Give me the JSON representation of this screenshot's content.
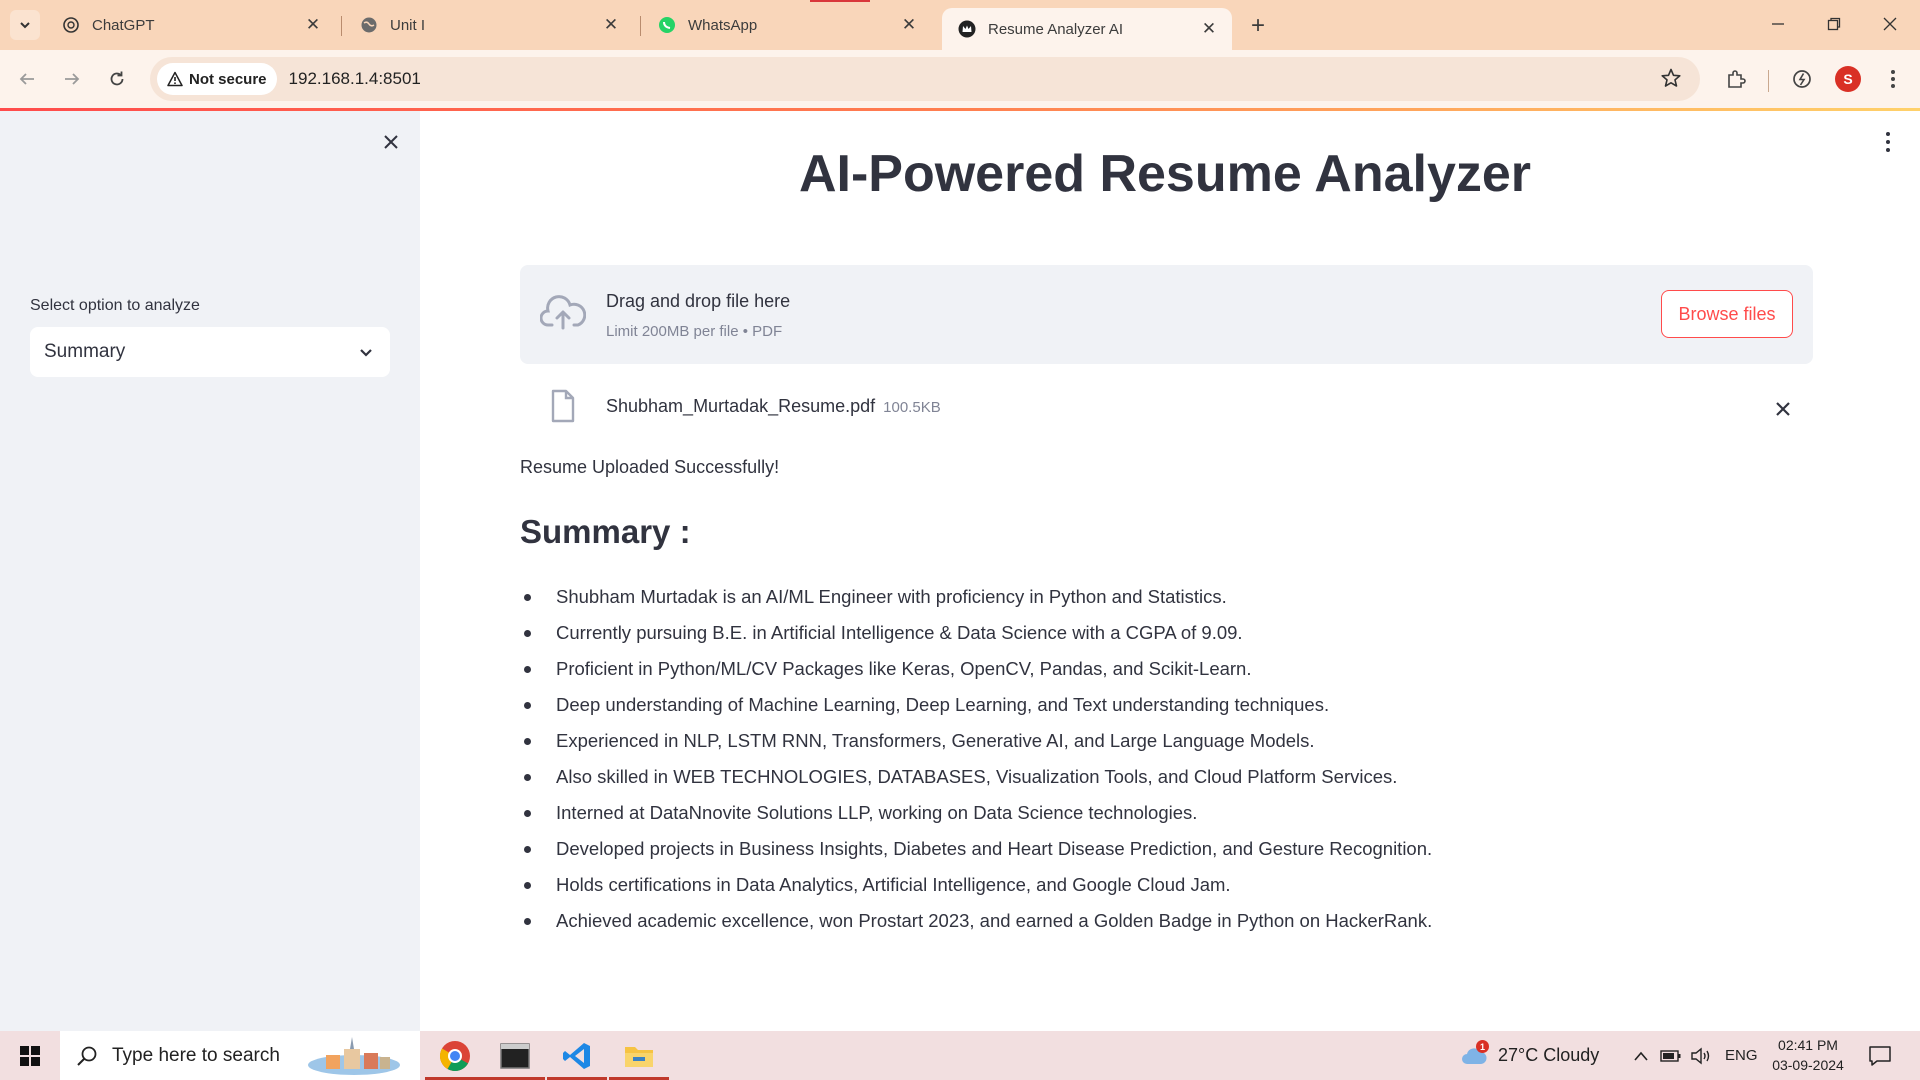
{
  "browser": {
    "tabs": [
      {
        "title": "ChatGPT",
        "icon": "chatgpt-icon"
      },
      {
        "title": "Unit I",
        "icon": "globe-icon"
      },
      {
        "title": "WhatsApp",
        "icon": "whatsapp-icon"
      },
      {
        "title": "Resume Analyzer AI",
        "icon": "streamlit-crown-icon",
        "active": true
      }
    ],
    "address": {
      "security_label": "Not secure",
      "url": "192.168.1.4:8501"
    },
    "profile_initial": "S"
  },
  "sidebar": {
    "select_label": "Select option to analyze",
    "select_value": "Summary"
  },
  "main": {
    "title": "AI-Powered Resume Analyzer",
    "uploader": {
      "title": "Drag and drop file here",
      "limit": "Limit 200MB per file • PDF",
      "browse_label": "Browse files"
    },
    "file": {
      "name": "Shubham_Murtadak_Resume.pdf",
      "size": "100.5KB"
    },
    "success_message": "Resume Uploaded Successfully!",
    "summary_heading": "Summary :",
    "summary_points": [
      "Shubham Murtadak is an AI/ML Engineer with proficiency in Python and Statistics.",
      "Currently pursuing B.E. in Artificial Intelligence & Data Science with a CGPA of 9.09.",
      "Proficient in Python/ML/CV Packages like Keras, OpenCV, Pandas, and Scikit-Learn.",
      "Deep understanding of Machine Learning, Deep Learning, and Text understanding techniques.",
      "Experienced in NLP, LSTM RNN, Transformers, Generative AI, and Large Language Models.",
      "Also skilled in WEB TECHNOLOGIES, DATABASES, Visualization Tools, and Cloud Platform Services.",
      "Interned at DataNnovite Solutions LLP, working on Data Science technologies.",
      "Developed projects in Business Insights, Diabetes and Heart Disease Prediction, and Gesture Recognition.",
      "Holds certifications in Data Analytics, Artificial Intelligence, and Google Cloud Jam.",
      "Achieved academic excellence, won Prostart 2023, and earned a Golden Badge in Python on HackerRank."
    ],
    "accent_color": "#ff4b4b"
  },
  "taskbar": {
    "search_placeholder": "Type here to search",
    "weather": "27°C  Cloudy",
    "weather_badge": "1",
    "language": "ENG",
    "time": "02:41 PM",
    "date": "03-09-2024"
  }
}
